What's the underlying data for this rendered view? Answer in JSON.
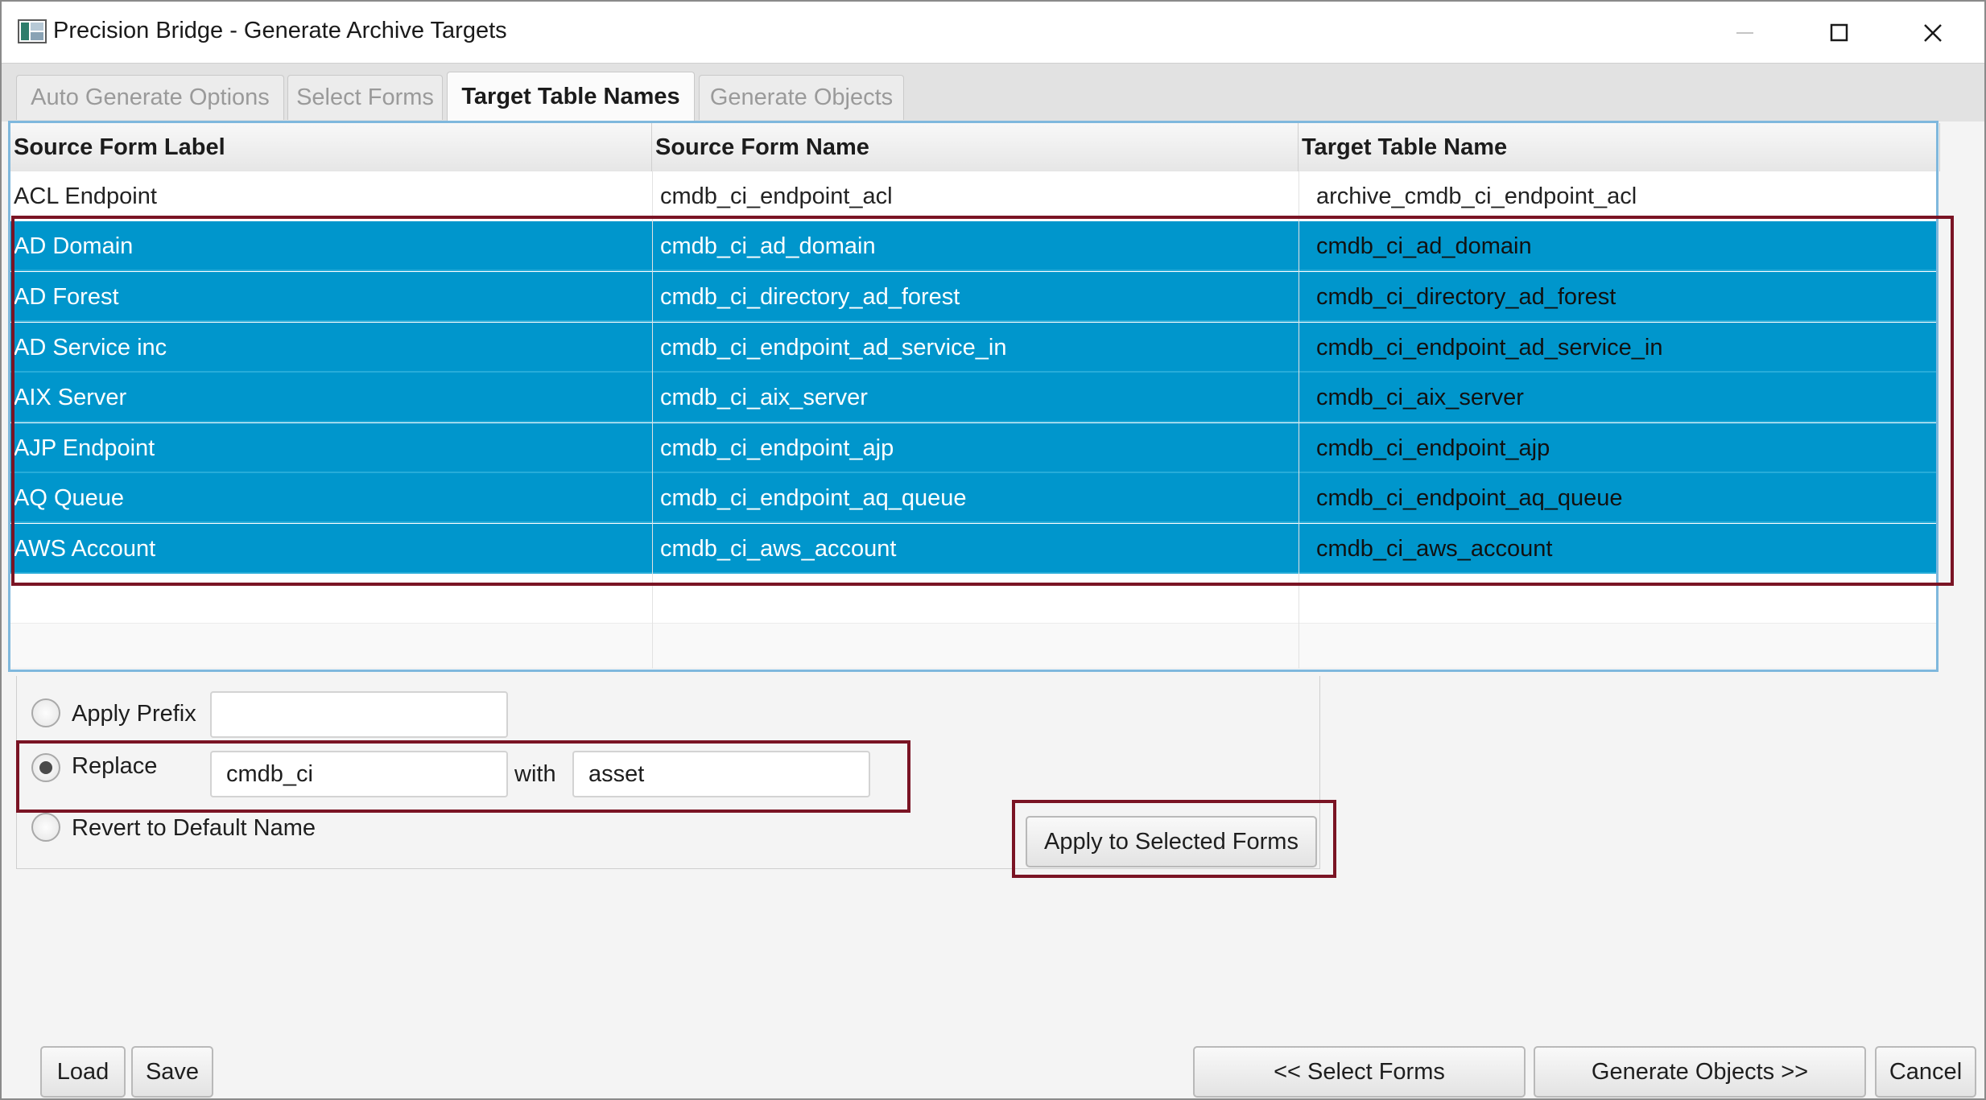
{
  "window": {
    "title": "Precision Bridge - Generate Archive Targets",
    "icon": "app-icon"
  },
  "tabs": [
    {
      "label": "Auto Generate Options",
      "active": false
    },
    {
      "label": "Select Forms",
      "active": false
    },
    {
      "label": "Target Table Names",
      "active": true
    },
    {
      "label": "Generate Objects",
      "active": false
    }
  ],
  "table": {
    "headers": [
      "Source Form Label",
      "Source Form Name",
      "Target Table Name"
    ],
    "rows": [
      {
        "label": "ACL Endpoint",
        "name": "cmdb_ci_endpoint_acl",
        "target": "archive_cmdb_ci_endpoint_acl",
        "selected": false
      },
      {
        "label": "AD Domain",
        "name": "cmdb_ci_ad_domain",
        "target": "cmdb_ci_ad_domain",
        "selected": true
      },
      {
        "label": "AD Forest",
        "name": "cmdb_ci_directory_ad_forest",
        "target": "cmdb_ci_directory_ad_forest",
        "selected": true
      },
      {
        "label": "AD Service inc",
        "name": "cmdb_ci_endpoint_ad_service_in",
        "target": "cmdb_ci_endpoint_ad_service_in",
        "selected": true
      },
      {
        "label": "AIX Server",
        "name": "cmdb_ci_aix_server",
        "target": "cmdb_ci_aix_server",
        "selected": true
      },
      {
        "label": "AJP Endpoint",
        "name": "cmdb_ci_endpoint_ajp",
        "target": "cmdb_ci_endpoint_ajp",
        "selected": true
      },
      {
        "label": "AQ Queue",
        "name": "cmdb_ci_endpoint_aq_queue",
        "target": "cmdb_ci_endpoint_aq_queue",
        "selected": true
      },
      {
        "label": "AWS Account",
        "name": "cmdb_ci_aws_account",
        "target": "cmdb_ci_aws_account",
        "selected": true
      }
    ]
  },
  "options": {
    "apply_prefix_label": "Apply Prefix",
    "prefix_value": "",
    "replace_label": "Replace",
    "replace_from": "cmdb_ci",
    "with_label": "with",
    "replace_to": "asset",
    "revert_label": "Revert to Default Name",
    "selected_option": "Replace",
    "apply_button": "Apply to Selected Forms"
  },
  "footer": {
    "load": "Load",
    "save": "Save",
    "back": "<< Select Forms",
    "next": "Generate Objects >>",
    "cancel": "Cancel"
  },
  "colors": {
    "selection": "#0096cc",
    "highlight_box": "#7a1424",
    "table_border": "#7fb8dd"
  }
}
